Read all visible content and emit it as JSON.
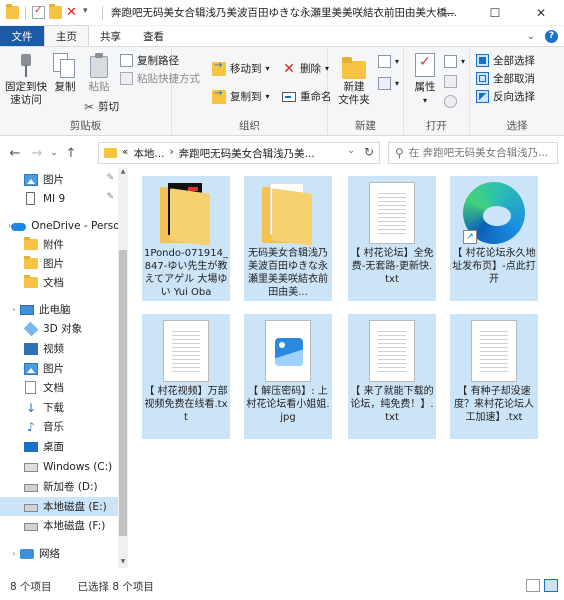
{
  "window": {
    "title": "奔跑吧无码美女合辑浅乃美波百田ゆきな永瀬里美美咲結衣前田由美大橋...",
    "controls": {
      "minimize": "—",
      "maximize": "☐",
      "close": "✕"
    }
  },
  "ribbon_tabs": [
    {
      "label": "文件"
    },
    {
      "label": "主页"
    },
    {
      "label": "共享"
    },
    {
      "label": "查看"
    }
  ],
  "ribbon": {
    "clipboard": {
      "label": "剪贴板",
      "pin": "固定到快\n速访问",
      "copy": "复制",
      "paste": "粘贴",
      "copy_path": "复制路径",
      "paste_shortcut": "粘贴快捷方式",
      "cut": "剪切"
    },
    "organize": {
      "label": "组织",
      "move_to": "移动到",
      "copy_to": "复制到",
      "delete": "删除",
      "rename": "重命名"
    },
    "new": {
      "label": "新建",
      "new_folder": "新建\n文件夹"
    },
    "open": {
      "label": "打开",
      "properties": "属性"
    },
    "select": {
      "label": "选择",
      "select_all": "全部选择",
      "select_none": "全部取消",
      "invert": "反向选择"
    }
  },
  "navigation": {
    "back": "←",
    "forward": "→",
    "recent": "⌄",
    "up": "↑",
    "breadcrumb": [
      "«",
      "本地...",
      "›",
      "奔跑吧无码美女合辑浅乃美..."
    ],
    "search_placeholder": "在 奔跑吧无码美女合辑浅乃..."
  },
  "sidebar": {
    "items": [
      {
        "label": "图片",
        "icon": "image-icon",
        "pinned": true,
        "level": 1
      },
      {
        "label": "MI 9",
        "icon": "phone-icon",
        "pinned": true,
        "level": 1
      },
      {
        "label": "OneDrive - Perso",
        "icon": "onedrive-icon",
        "chevron": "›",
        "level": 0
      },
      {
        "label": "附件",
        "icon": "folder-icon",
        "level": 1
      },
      {
        "label": "图片",
        "icon": "folder-icon",
        "level": 1
      },
      {
        "label": "文档",
        "icon": "folder-icon",
        "level": 1
      },
      {
        "label": "此电脑",
        "icon": "pc-icon",
        "chevron": "›",
        "level": 0
      },
      {
        "label": "3D 对象",
        "icon": "3d-objects-icon",
        "level": 1
      },
      {
        "label": "视频",
        "icon": "video-icon",
        "level": 1
      },
      {
        "label": "图片",
        "icon": "image-icon",
        "level": 1
      },
      {
        "label": "文档",
        "icon": "document-icon",
        "level": 1
      },
      {
        "label": "下载",
        "icon": "download-icon",
        "level": 1
      },
      {
        "label": "音乐",
        "icon": "music-icon",
        "level": 1
      },
      {
        "label": "桌面",
        "icon": "desktop-icon",
        "level": 1
      },
      {
        "label": "Windows (C:)",
        "icon": "windows-drive-icon",
        "level": 1
      },
      {
        "label": "新加卷 (D:)",
        "icon": "drive-icon",
        "level": 1
      },
      {
        "label": "本地磁盘 (E:)",
        "icon": "drive-icon",
        "level": 1,
        "selected": true
      },
      {
        "label": "本地磁盘 (F:)",
        "icon": "drive-icon",
        "level": 1
      },
      {
        "label": "网络",
        "icon": "network-icon",
        "chevron": "›",
        "level": 0
      }
    ]
  },
  "files": [
    {
      "name": "1Pondo-071914_847-ゆい先生が教えてアゲル 大場ゆい Yui Oba",
      "type": "folder-dark"
    },
    {
      "name": "无码美女合辑浅乃美波百田ゆきな永瀬里美美咲結衣前田由美...",
      "type": "folder"
    },
    {
      "name": "【 村花论坛】全免费-无套路-更新快.txt",
      "type": "txt"
    },
    {
      "name": "【 村花论坛永久地址发布页】-点此打开",
      "type": "edge-shortcut"
    },
    {
      "name": "【 村花视频】万部视频免费在线看.txt",
      "type": "txt"
    },
    {
      "name": "【 解压密码】: 上村花论坛看小姐姐.jpg",
      "type": "jpg"
    },
    {
      "name": "【 来了就能下载的论坛，纯免费！】.txt",
      "type": "txt"
    },
    {
      "name": "【 有种子却没速度？来村花论坛人工加速】.txt",
      "type": "txt"
    }
  ],
  "status": {
    "item_count": "8 个项目",
    "selected_count": "已选择 8 个项目"
  }
}
